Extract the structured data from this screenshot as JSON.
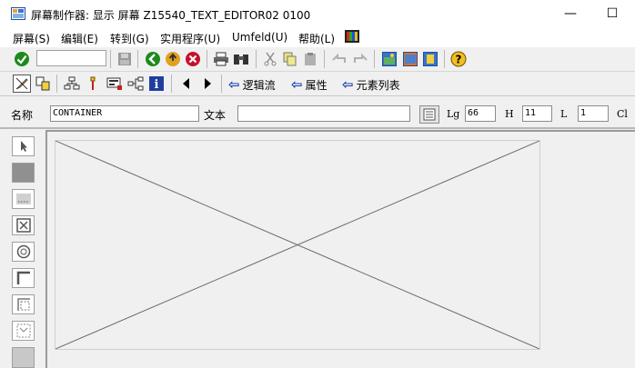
{
  "window": {
    "title": "屏幕制作器:  显示 屏幕 Z15540_TEXT_EDITOR02 0100",
    "minimize_glyph": "—",
    "maximize_glyph": "☐"
  },
  "menu": [
    {
      "label": "屏幕(S)"
    },
    {
      "label": "编辑(E)"
    },
    {
      "label": "转到(G)"
    },
    {
      "label": "实用程序(U)"
    },
    {
      "label": "Umfeld(U)"
    },
    {
      "label": "帮助(L)"
    }
  ],
  "toolbar2": {
    "logic_flow": "逻辑流",
    "attributes": "属性",
    "element_list": "元素列表"
  },
  "fields": {
    "name_label": "名称",
    "name_value": "CONTAINER",
    "text_label": "文本",
    "text_value": "",
    "lg_label": "Lg",
    "lg_value": "66",
    "h_label": "H",
    "h_value": "11",
    "l_label": "L",
    "l_value": "1",
    "cl_label": "Cl"
  },
  "colors": {
    "titlebar": "#ffffff",
    "background": "#f0f0f0",
    "arrow_blue": "#1b3fb5",
    "check_green": "#1c8a1c",
    "cancel_red": "#c8102e"
  }
}
